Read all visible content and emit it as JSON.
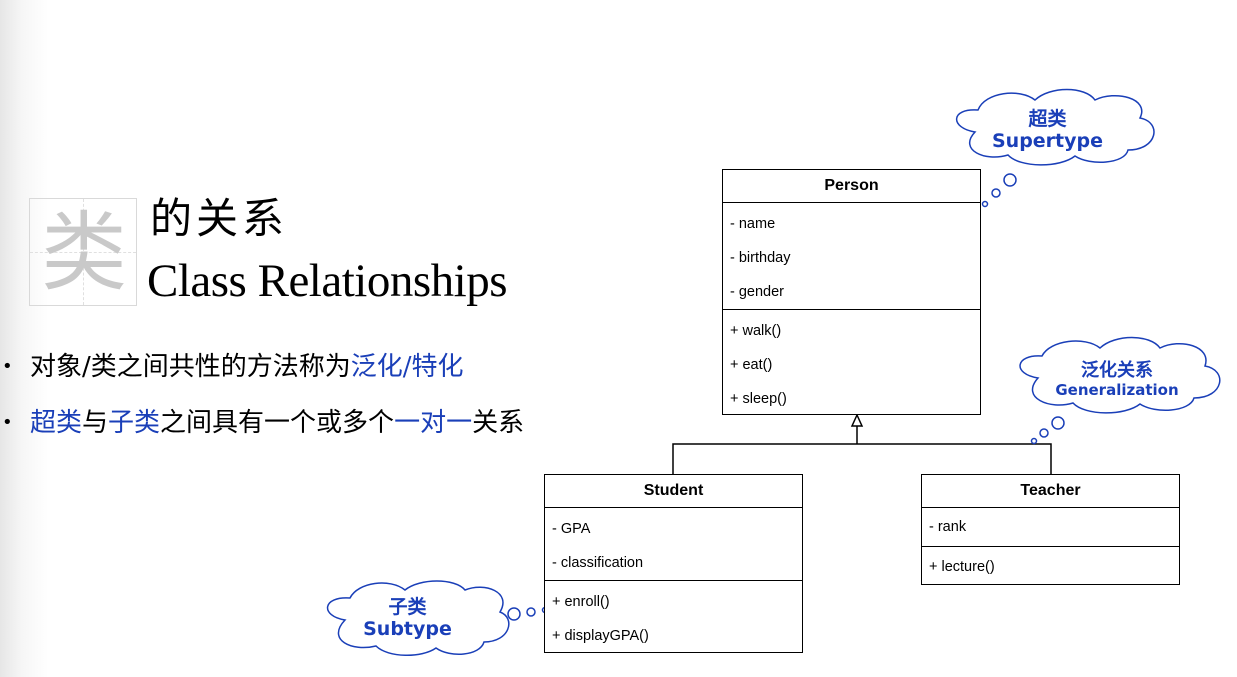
{
  "title": {
    "char": "类",
    "cn": "的关系",
    "en": "Class Relationships"
  },
  "bullets": [
    {
      "parts": [
        {
          "t": "对象/类之间共性的方法称为",
          "hl": false
        },
        {
          "t": "泛化/特化",
          "hl": true
        }
      ]
    },
    {
      "parts": [
        {
          "t": "超类",
          "hl": true
        },
        {
          "t": "与",
          "hl": false
        },
        {
          "t": "子类",
          "hl": true
        },
        {
          "t": "之间具有一个或多个",
          "hl": false
        },
        {
          "t": "一对一",
          "hl": true
        },
        {
          "t": "关系",
          "hl": false
        }
      ]
    }
  ],
  "classes": {
    "person": {
      "name": "Person",
      "attributes": [
        "- name",
        "- birthday",
        "- gender"
      ],
      "methods": [
        "+ walk()",
        "+ eat()",
        "+ sleep()"
      ]
    },
    "student": {
      "name": "Student",
      "attributes": [
        "- GPA",
        "- classification"
      ],
      "methods": [
        "+ enroll()",
        "+ displayGPA()"
      ]
    },
    "teacher": {
      "name": "Teacher",
      "attributes": [
        "- rank"
      ],
      "methods": [
        "+ lecture()"
      ]
    }
  },
  "callouts": {
    "supertype": {
      "cn": "超类",
      "en": "Supertype"
    },
    "generalization": {
      "cn": "泛化关系",
      "en": "Generalization"
    },
    "subtype": {
      "cn": "子类",
      "en": "Subtype"
    }
  },
  "colors": {
    "highlight": "#1a3fb8",
    "line": "#000000"
  }
}
